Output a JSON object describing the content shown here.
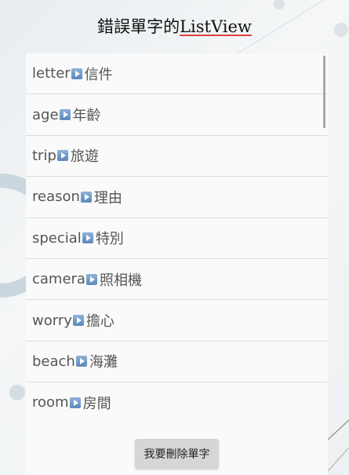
{
  "title_prefix": "錯誤單字的",
  "title_suffix": "ListView",
  "items": [
    {
      "en": "letter",
      "zh": "信件"
    },
    {
      "en": "age",
      "zh": "年齡"
    },
    {
      "en": "trip",
      "zh": "旅遊"
    },
    {
      "en": "reason",
      "zh": "理由"
    },
    {
      "en": "special",
      "zh": "特別"
    },
    {
      "en": "camera",
      "zh": "照相機"
    },
    {
      "en": "worry",
      "zh": "擔心"
    },
    {
      "en": "beach",
      "zh": "海灘"
    },
    {
      "en": "room",
      "zh": "房間"
    }
  ],
  "delete_button": "我要刪除單字"
}
